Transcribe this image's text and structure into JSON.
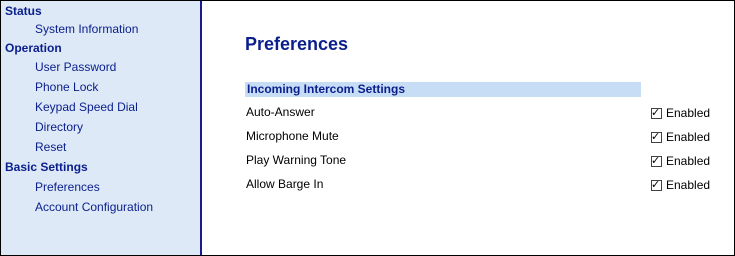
{
  "sidebar": {
    "sections": [
      {
        "title": "Status",
        "items": [
          {
            "label": "System Information"
          }
        ]
      },
      {
        "title": "Operation",
        "items": [
          {
            "label": "User Password"
          },
          {
            "label": "Phone Lock"
          },
          {
            "label": "Keypad Speed Dial"
          },
          {
            "label": "Directory"
          },
          {
            "label": "Reset"
          }
        ]
      },
      {
        "title": "Basic Settings",
        "items": [
          {
            "label": "Preferences"
          },
          {
            "label": "Account Configuration"
          }
        ]
      }
    ]
  },
  "main": {
    "title": "Preferences",
    "section_header": "Incoming Intercom Settings",
    "rows": [
      {
        "label": "Auto-Answer",
        "checked": true,
        "check_label": "Enabled"
      },
      {
        "label": "Microphone Mute",
        "checked": true,
        "check_label": "Enabled"
      },
      {
        "label": "Play Warning Tone",
        "checked": true,
        "check_label": "Enabled"
      },
      {
        "label": "Allow Barge In",
        "checked": true,
        "check_label": "Enabled"
      }
    ]
  },
  "colors": {
    "nav_text": "#0a1e8c",
    "sidebar_bg": "#dde9f7",
    "header_bar": "#c7ddf6"
  }
}
